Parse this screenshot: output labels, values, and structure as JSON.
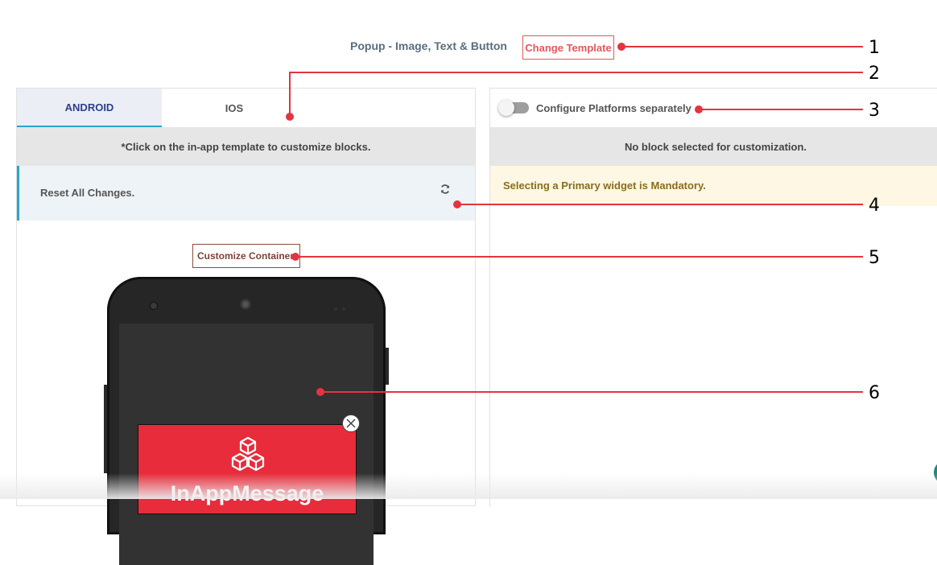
{
  "header": {
    "template_name": "Popup - Image, Text & Button",
    "change_template_label": "Change Template"
  },
  "left_panel": {
    "tabs": [
      {
        "label": "ANDROID",
        "active": true
      },
      {
        "label": "IOS",
        "active": false
      }
    ],
    "hint": "*Click on the in-app template to customize blocks.",
    "reset_label": "Reset All Changes.",
    "customize_container_label": "Customize Container",
    "popup_title": "InAppMessage"
  },
  "right_panel": {
    "configure_label": "Configure Platforms separately",
    "configure_enabled": false,
    "no_block_text": "No block selected for customization.",
    "warning_text": "Selecting a Primary widget is Mandatory."
  },
  "callouts": [
    "1",
    "2",
    "3",
    "4",
    "5",
    "6"
  ],
  "colors": {
    "accent_red": "#e5343f",
    "tab_active_text": "#2d3e8f",
    "tab_indicator": "#2aa6c9",
    "popup_bg": "#e82c3b",
    "warning_text": "#8a6d1e"
  }
}
